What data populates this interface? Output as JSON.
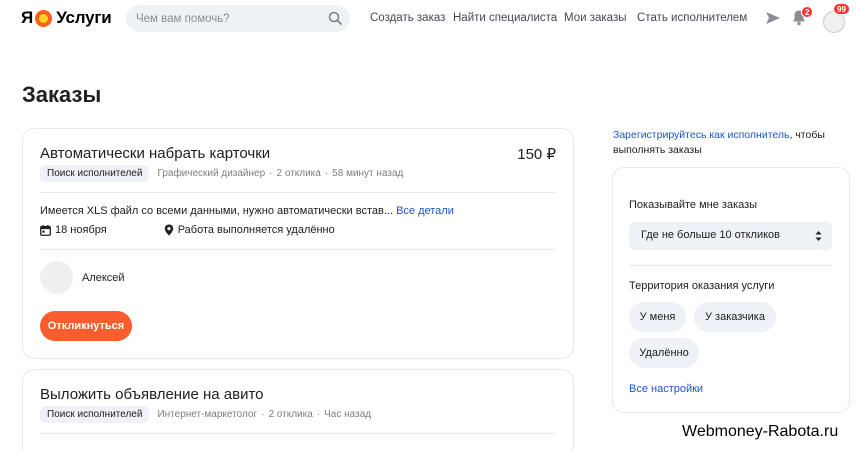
{
  "header": {
    "logo_mark": "Я",
    "logo_text": "Услуги",
    "search_placeholder": "Чем вам помочь?",
    "nav": [
      "Создать заказ",
      "Найти специалиста",
      "Мои заказы",
      "Стать исполнителем"
    ],
    "notifications_count": "2",
    "avatar_badge": "99"
  },
  "page_title": "Заказы",
  "orders": [
    {
      "title": "Автоматически набрать карточки",
      "price": "150 ₽",
      "status_chip": "Поиск исполнителей",
      "category": "Графический дизайнер",
      "responses": "2 отклика",
      "time": "58 минут назад",
      "description": "Имеется XLS файл со всеми данными, нужно автоматически встав...",
      "more_link": "Все детали",
      "date": "18 ноября",
      "location": "Работа выполняется удалённо",
      "customer": "Алексей",
      "respond_button": "Откликнуться"
    },
    {
      "title": "Выложить объявление на авито",
      "status_chip": "Поиск исполнителей",
      "category": "Интернет-маркетолог",
      "responses": "2 отклика",
      "time": "Час назад"
    }
  ],
  "sidebar": {
    "register_link": "Зарегистрируйтесь как исполнитель",
    "register_rest": ", чтобы выполнять заказы",
    "show_label": "Показывайте мне заказы",
    "show_value": "Где не больше 10 откликов",
    "territory_label": "Территория оказания услуги",
    "territory_options": [
      "У меня",
      "У заказчика",
      "Удалённо"
    ],
    "all_settings": "Все настройки"
  },
  "watermark": "Webmoney-Rabota.ru",
  "colors": {
    "accent_button": "#fc5d2e",
    "link": "#1c56c6",
    "badge": "#ff3333",
    "chip_bg": "#eef1f5"
  }
}
